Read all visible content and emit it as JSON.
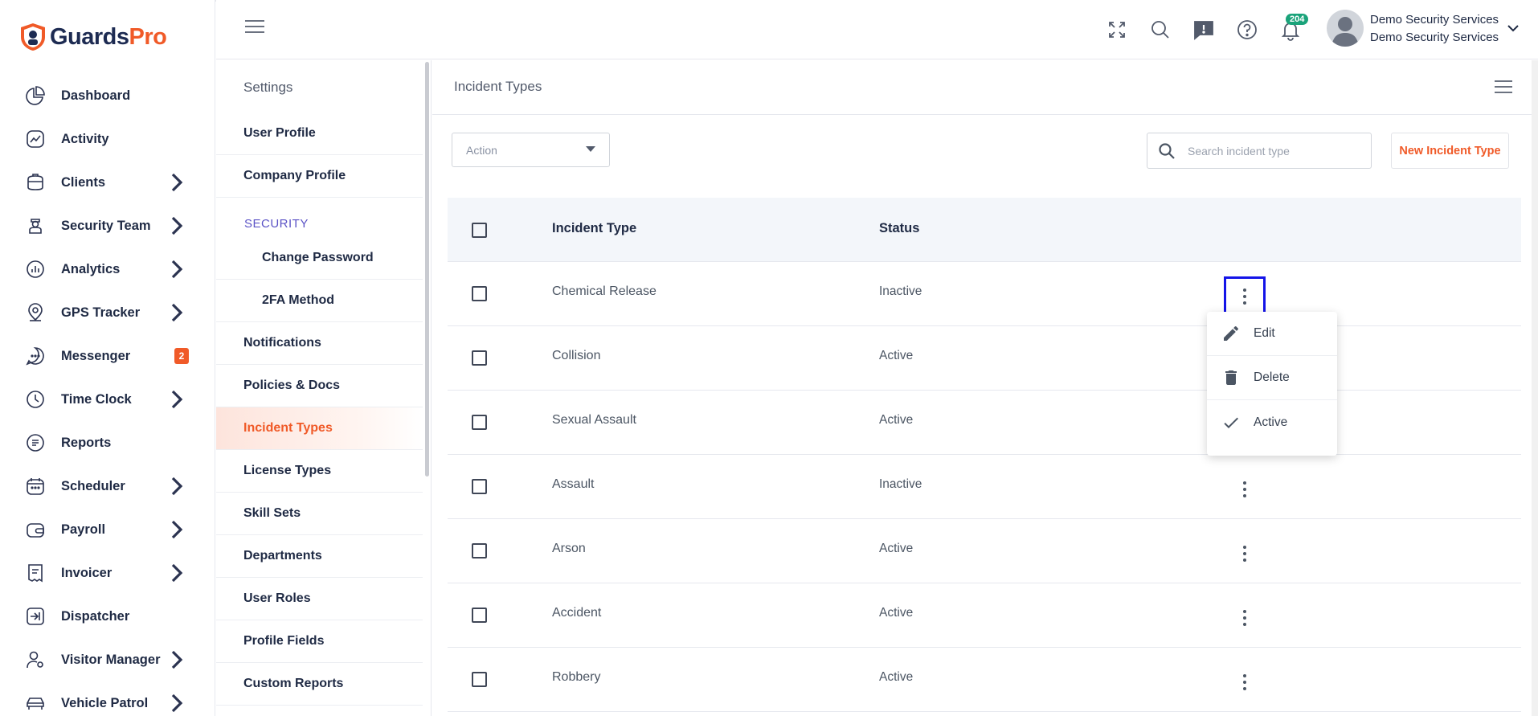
{
  "brand": {
    "name_part1": "Guards",
    "name_part2": "Pro",
    "accent": "#f05a28",
    "navy": "#1d2b52"
  },
  "sidebar": {
    "items": [
      {
        "label": "Dashboard",
        "icon": "pie-chart-icon",
        "chevron": false
      },
      {
        "label": "Activity",
        "icon": "activity-icon",
        "chevron": false
      },
      {
        "label": "Clients",
        "icon": "briefcase-icon",
        "chevron": true
      },
      {
        "label": "Security Team",
        "icon": "guard-icon",
        "chevron": true
      },
      {
        "label": "Analytics",
        "icon": "analytics-icon",
        "chevron": true
      },
      {
        "label": "GPS Tracker",
        "icon": "map-pin-icon",
        "chevron": true
      },
      {
        "label": "Messenger",
        "icon": "chat-icon",
        "chevron": false,
        "badge": "2"
      },
      {
        "label": "Time Clock",
        "icon": "clock-icon",
        "chevron": true
      },
      {
        "label": "Reports",
        "icon": "report-icon",
        "chevron": false
      },
      {
        "label": "Scheduler",
        "icon": "calendar-icon",
        "chevron": true
      },
      {
        "label": "Payroll",
        "icon": "wallet-icon",
        "chevron": true
      },
      {
        "label": "Invoicer",
        "icon": "invoice-icon",
        "chevron": true
      },
      {
        "label": "Dispatcher",
        "icon": "dispatch-icon",
        "chevron": false
      },
      {
        "label": "Visitor Manager",
        "icon": "visitor-icon",
        "chevron": true
      },
      {
        "label": "Vehicle Patrol",
        "icon": "car-icon",
        "chevron": true
      }
    ]
  },
  "header": {
    "notification_count": "204",
    "user_name": "Demo Security Services",
    "user_company": "Demo Security Services"
  },
  "settings": {
    "title": "Settings",
    "items_top": [
      "User Profile",
      "Company Profile"
    ],
    "security_section": "SECURITY",
    "security_items": [
      "Change Password",
      "2FA Method"
    ],
    "items_bottom": [
      "Notifications",
      "Policies & Docs",
      "Incident Types",
      "License Types",
      "Skill Sets",
      "Departments",
      "User Roles",
      "Profile Fields",
      "Custom Reports"
    ],
    "active": "Incident Types"
  },
  "main": {
    "title": "Incident Types",
    "action_placeholder": "Action",
    "search_placeholder": "Search incident type",
    "new_button": "New Incident Type",
    "columns": {
      "type": "Incident Type",
      "status": "Status"
    },
    "rows": [
      {
        "type": "Chemical Release",
        "status": "Inactive"
      },
      {
        "type": "Collision",
        "status": "Active"
      },
      {
        "type": "Sexual Assault",
        "status": "Active"
      },
      {
        "type": "Assault",
        "status": "Inactive"
      },
      {
        "type": "Arson",
        "status": "Active"
      },
      {
        "type": "Accident",
        "status": "Active"
      },
      {
        "type": "Robbery",
        "status": "Active"
      }
    ],
    "menu": {
      "edit": "Edit",
      "delete": "Delete",
      "active": "Active"
    }
  }
}
